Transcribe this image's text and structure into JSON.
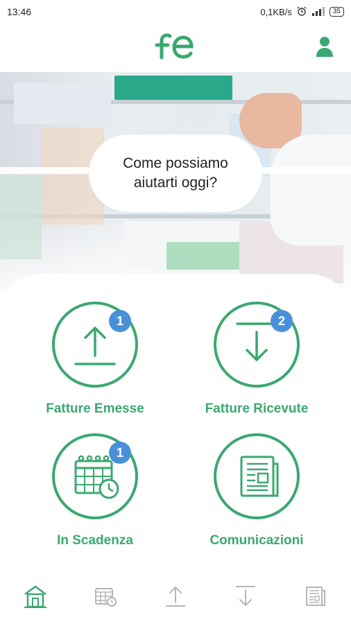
{
  "status_bar": {
    "time": "13:46",
    "network_speed": "0,1KB/s",
    "battery": "35",
    "icons": [
      "alarm-icon",
      "signal-icon"
    ]
  },
  "header": {
    "logo_text": "fe",
    "profile_icon": "user-icon"
  },
  "hero": {
    "bubble_line1": "Come possiamo",
    "bubble_line2": "aiutarti oggi?"
  },
  "tiles": [
    {
      "label": "Fatture Emesse",
      "badge": "1",
      "icon": "upload-icon"
    },
    {
      "label": "Fatture Ricevute",
      "badge": "2",
      "icon": "download-icon"
    },
    {
      "label": "In Scadenza",
      "badge": "1",
      "icon": "calendar-clock-icon"
    },
    {
      "label": "Comunicazioni",
      "badge": "",
      "icon": "newspaper-icon"
    }
  ],
  "bottom_nav": [
    {
      "icon": "home-icon",
      "active": true
    },
    {
      "icon": "calendar-clock-icon",
      "active": false
    },
    {
      "icon": "upload-icon",
      "active": false
    },
    {
      "icon": "download-icon",
      "active": false
    },
    {
      "icon": "newspaper-icon",
      "active": false
    }
  ],
  "colors": {
    "accent": "#3aa870",
    "badge": "#4a90d9",
    "nav_inactive": "#b5b5b5"
  }
}
